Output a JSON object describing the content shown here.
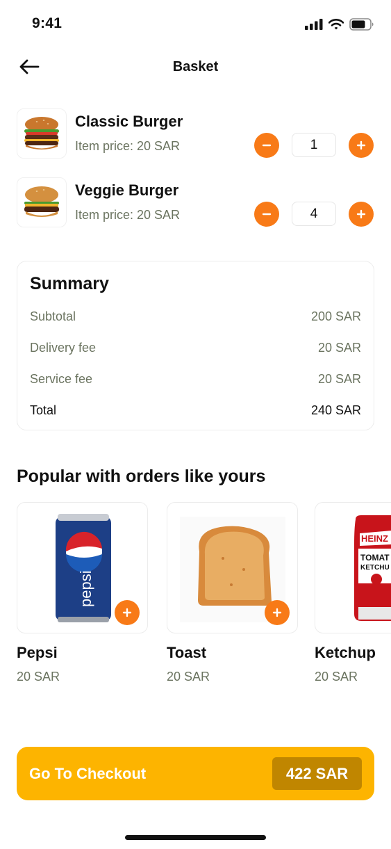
{
  "status_bar": {
    "time": "9:41"
  },
  "header": {
    "title": "Basket",
    "back_icon": "arrow-left-icon"
  },
  "basket": {
    "items": [
      {
        "name": "Classic Burger",
        "price_label": "Item price: 20 SAR",
        "quantity": "1",
        "image": "burger-image"
      },
      {
        "name": "Veggie Burger",
        "price_label": "Item price: 20 SAR",
        "quantity": "4",
        "image": "burger-image"
      }
    ]
  },
  "summary": {
    "title": "Summary",
    "rows": [
      {
        "label": "Subtotal",
        "value": "200 SAR"
      },
      {
        "label": "Delivery fee",
        "value": "20 SAR"
      },
      {
        "label": "Service fee",
        "value": "20 SAR"
      },
      {
        "label": "Total",
        "value": "240 SAR"
      }
    ]
  },
  "popular": {
    "title": "Popular with orders like yours",
    "items": [
      {
        "name": "Pepsi",
        "price": "20 SAR",
        "image": "pepsi-can-image"
      },
      {
        "name": "Toast",
        "price": "20 SAR",
        "image": "toast-image"
      },
      {
        "name": "Ketchup",
        "price": "20 SAR",
        "image": "ketchup-bottle-image"
      }
    ]
  },
  "checkout": {
    "label": "Go To Checkout",
    "total": "422 SAR"
  },
  "colors": {
    "accent": "#f87a17",
    "checkout": "#fdb400",
    "checkout_badge": "#c08600",
    "muted_text": "#6b7460"
  }
}
